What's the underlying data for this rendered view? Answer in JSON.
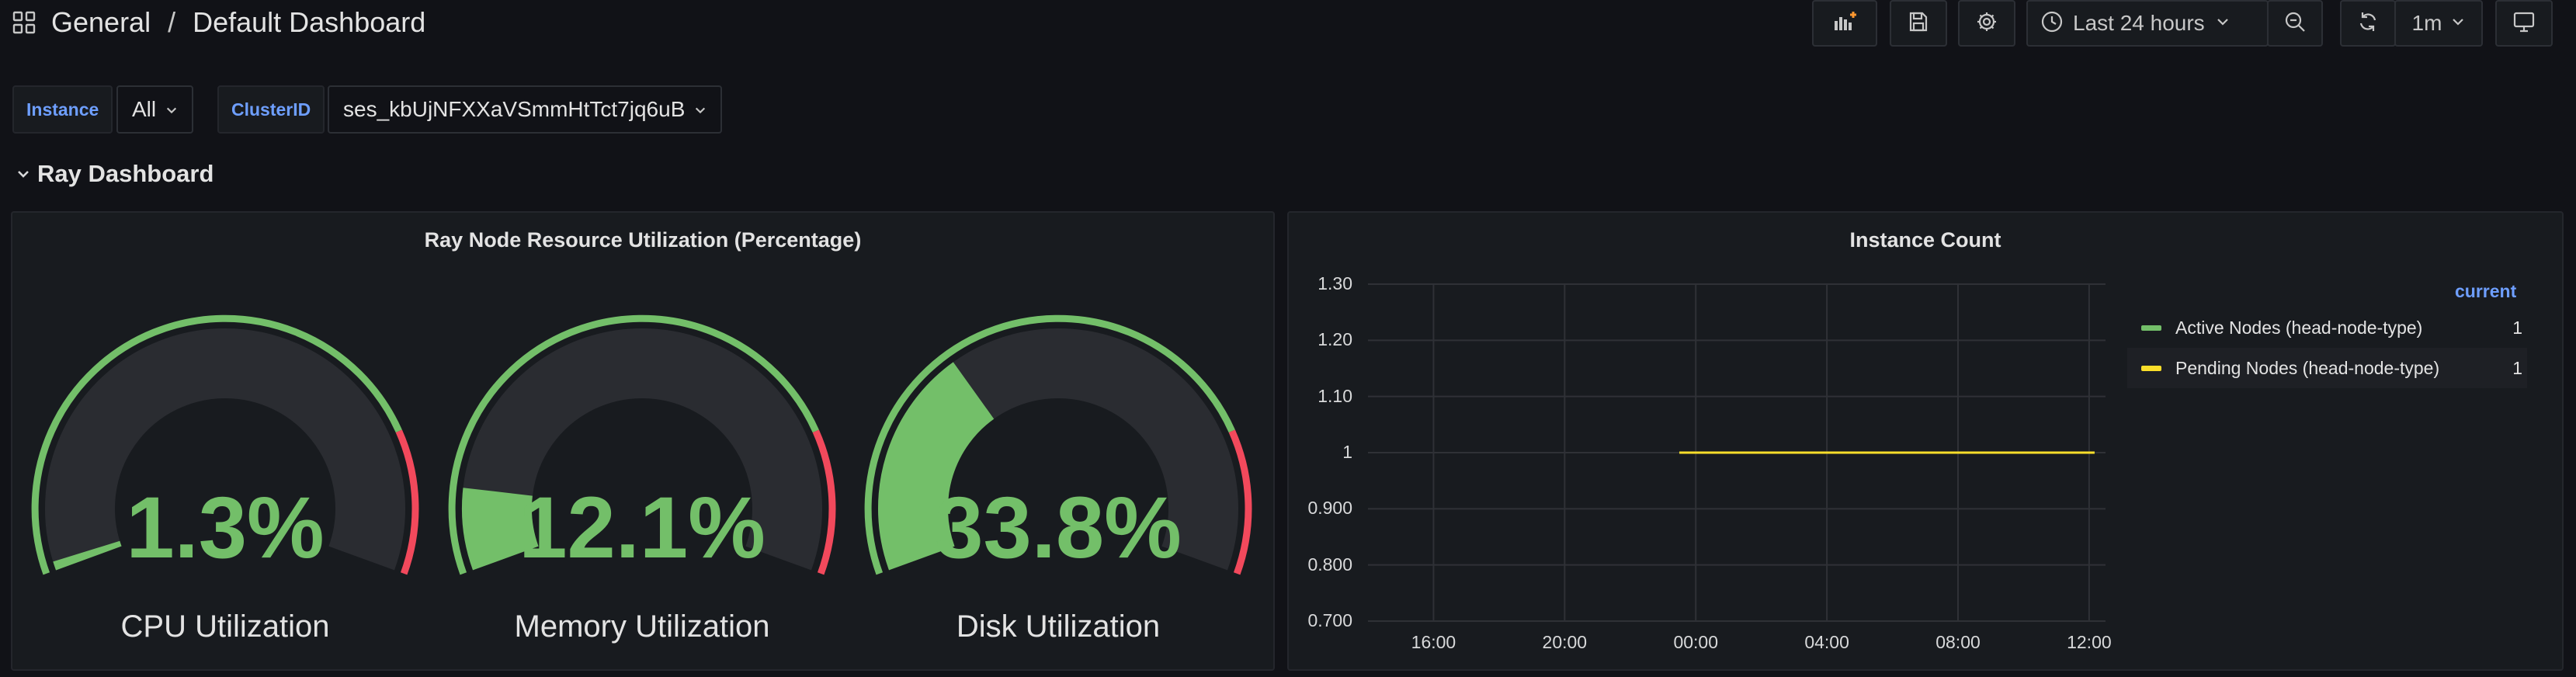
{
  "header": {
    "folder": "General",
    "separator": "/",
    "title": "Default Dashboard",
    "time_range": "Last 24 hours",
    "refresh_interval": "1m"
  },
  "variables": [
    {
      "label": "Instance",
      "value": "All"
    },
    {
      "label": "ClusterID",
      "value": "ses_kbUjNFXXaVSmmHtTct7jq6uB"
    }
  ],
  "row": {
    "title": "Ray Dashboard"
  },
  "resource_panel": {
    "title": "Ray Node Resource Utilization (Percentage)",
    "gauges": [
      {
        "name": "CPU Utilization",
        "display": "1.3%",
        "value": 1.3
      },
      {
        "name": "Memory Utilization",
        "display": "12.1%",
        "value": 12.1
      },
      {
        "name": "Disk Utilization",
        "display": "33.8%",
        "value": 33.8
      }
    ],
    "colors": {
      "ok": "#73bf69",
      "critical": "#f2495c",
      "track": "#2a2c31"
    }
  },
  "instance_panel": {
    "title": "Instance Count",
    "legend_header": "current"
  },
  "chart_data": {
    "type": "line",
    "title": "Instance Count",
    "x": [
      "16:00",
      "20:00",
      "00:00",
      "04:00",
      "08:00",
      "12:00"
    ],
    "y_ticks": [
      "1.30",
      "1.20",
      "1.10",
      "1",
      "0.900",
      "0.800",
      "0.700"
    ],
    "ylim": [
      0.7,
      1.3
    ],
    "grid": true,
    "legend_position": "right",
    "series": [
      {
        "name": "Active Nodes (head-node-type)",
        "color": "#73bf69",
        "current": "1",
        "points": [
          [
            "23:30",
            1
          ],
          [
            "12:10",
            1
          ]
        ]
      },
      {
        "name": "Pending Nodes (head-node-type)",
        "color": "#fade2a",
        "current": "1",
        "points": [
          [
            "23:30",
            1
          ],
          [
            "12:10",
            1
          ]
        ]
      }
    ]
  }
}
